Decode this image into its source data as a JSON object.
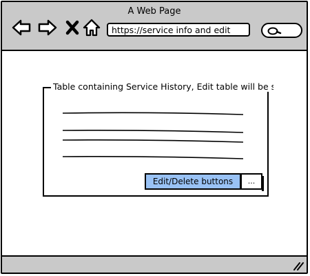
{
  "window": {
    "title": "A Web Page"
  },
  "toolbar": {
    "back_icon": "back-arrow-icon",
    "forward_icon": "forward-arrow-icon",
    "close_icon": "close-x-icon",
    "home_icon": "home-icon",
    "url": "https://service info and edit",
    "search_icon": "search-icon"
  },
  "panel": {
    "title": "Table containing Service History, Edit table will be simi",
    "rows": 4,
    "edit_button_label": "Edit/Delete buttons",
    "more_button_label": "..."
  },
  "colors": {
    "chrome": "#c9c9c9",
    "button_accent": "#99c2f5"
  }
}
